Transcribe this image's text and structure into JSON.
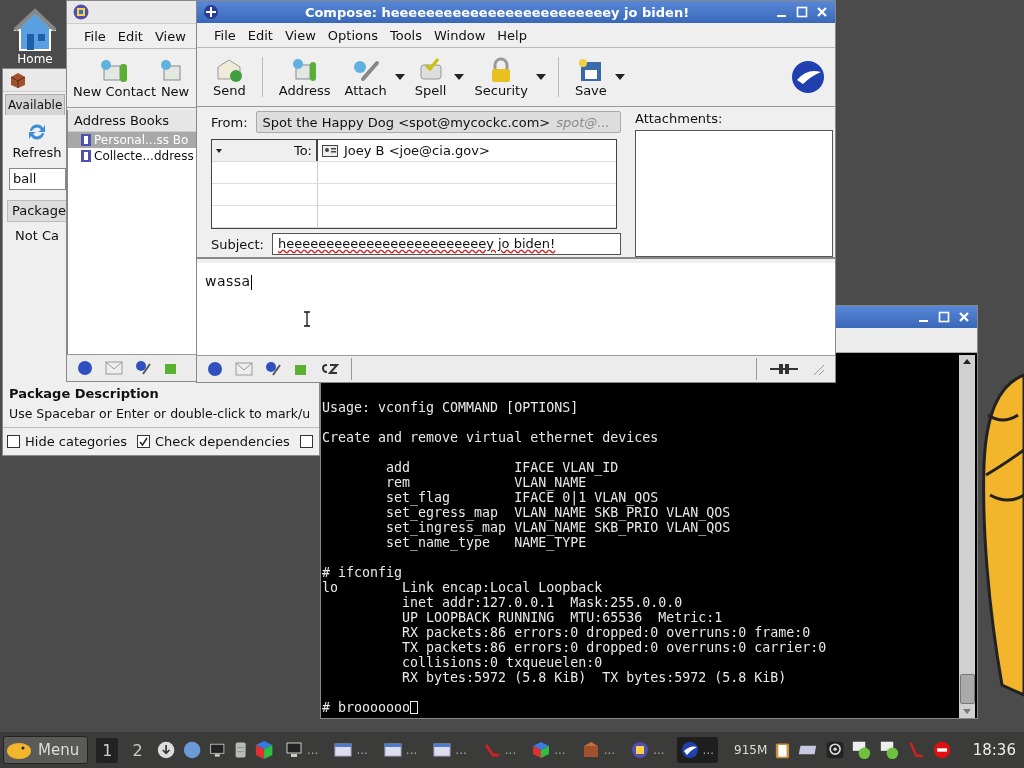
{
  "desktop": {
    "icons": [
      {
        "label": "Home"
      }
    ]
  },
  "package_window": {
    "tabs": [
      {
        "label": "Available",
        "selected": true
      }
    ],
    "refresh_label": "Refresh",
    "search": {
      "value": "ball"
    },
    "column_header": "Package",
    "row": "Not Ca",
    "description": {
      "title": "Package Description",
      "hint": "Use Spacebar or Enter or double-click to mark/u"
    },
    "options": [
      {
        "label": "Hide categories",
        "checked": false
      },
      {
        "label": "Check dependencies",
        "checked": true
      },
      {
        "checked": false
      }
    ]
  },
  "address_book_window": {
    "menu": [
      "File",
      "Edit",
      "View"
    ],
    "toolbar": [
      "New Contact",
      "New"
    ],
    "panel_title": "Address Books",
    "books": [
      {
        "label": "Personal...ss Bo",
        "selected": true
      },
      {
        "label": "Collecte...ddress",
        "selected": false
      }
    ]
  },
  "compose_window": {
    "title": "Compose: heeeeeeeeeeeeeeeeeeeeeeeeey jo biden!",
    "menu": [
      "File",
      "Edit",
      "View",
      "Options",
      "Tools",
      "Window",
      "Help"
    ],
    "toolbar_groups": [
      [
        {
          "label": "Send",
          "dropdown": false
        }
      ],
      [
        {
          "label": "Address",
          "dropdown": false
        },
        {
          "label": "Attach",
          "dropdown": true
        },
        {
          "label": "Spell",
          "dropdown": true
        },
        {
          "label": "Security",
          "dropdown": true
        }
      ],
      [
        {
          "label": "Save",
          "dropdown": true
        }
      ]
    ],
    "from_label": "From:",
    "from_value": "Spot the Happy Dog <spot@mycockc.com>",
    "from_hint": "spot@...",
    "recipients": [
      {
        "type": "To:",
        "address": "Joey B <joe@cia.gov>"
      }
    ],
    "subject_label": "Subject:",
    "subject": "heeeeeeeeeeeeeeeeeeeeeeeeey jo biden!",
    "attachments_label": "Attachments:",
    "body": "wassa"
  },
  "terminal_window": {
    "blocks": [
      [
        "Usage: vconfig COMMAND [OPTIONS]"
      ],
      [
        "Create and remove virtual ethernet devices"
      ],
      [
        "        add             IFACE VLAN_ID",
        "        rem             VLAN_NAME",
        "        set_flag        IFACE 0|1 VLAN_QOS",
        "        set_egress_map  VLAN_NAME SKB_PRIO VLAN_QOS",
        "        set_ingress_map VLAN_NAME SKB_PRIO VLAN_QOS",
        "        set_name_type   NAME_TYPE"
      ],
      [
        "# ifconfig",
        "lo        Link encap:Local Loopback",
        "          inet addr:127.0.0.1  Mask:255.0.0.0",
        "          UP LOOPBACK RUNNING  MTU:65536  Metric:1",
        "          RX packets:86 errors:0 dropped:0 overruns:0 frame:0",
        "          TX packets:86 errors:0 dropped:0 overruns:0 carrier:0",
        "          collisions:0 txqueuelen:0",
        "          RX bytes:5972 (5.8 KiB)  TX bytes:5972 (5.8 KiB)"
      ],
      [
        "# brooooooo"
      ]
    ]
  },
  "taskbar": {
    "menu_label": "Menu",
    "workspaces": [
      {
        "label": "1",
        "selected": true
      },
      {
        "label": "2",
        "selected": false
      }
    ],
    "tasks": [
      {
        "label": "...",
        "selected": false
      },
      {
        "label": "...",
        "selected": false
      },
      {
        "label": "...",
        "selected": false
      },
      {
        "label": "...",
        "selected": false
      },
      {
        "label": "...",
        "selected": false
      },
      {
        "label": "...",
        "selected": false
      },
      {
        "label": "...",
        "selected": false
      },
      {
        "label": "...",
        "selected": false
      },
      {
        "label": "...",
        "selected": true
      }
    ],
    "memory": "915M",
    "clock": "18:36"
  }
}
